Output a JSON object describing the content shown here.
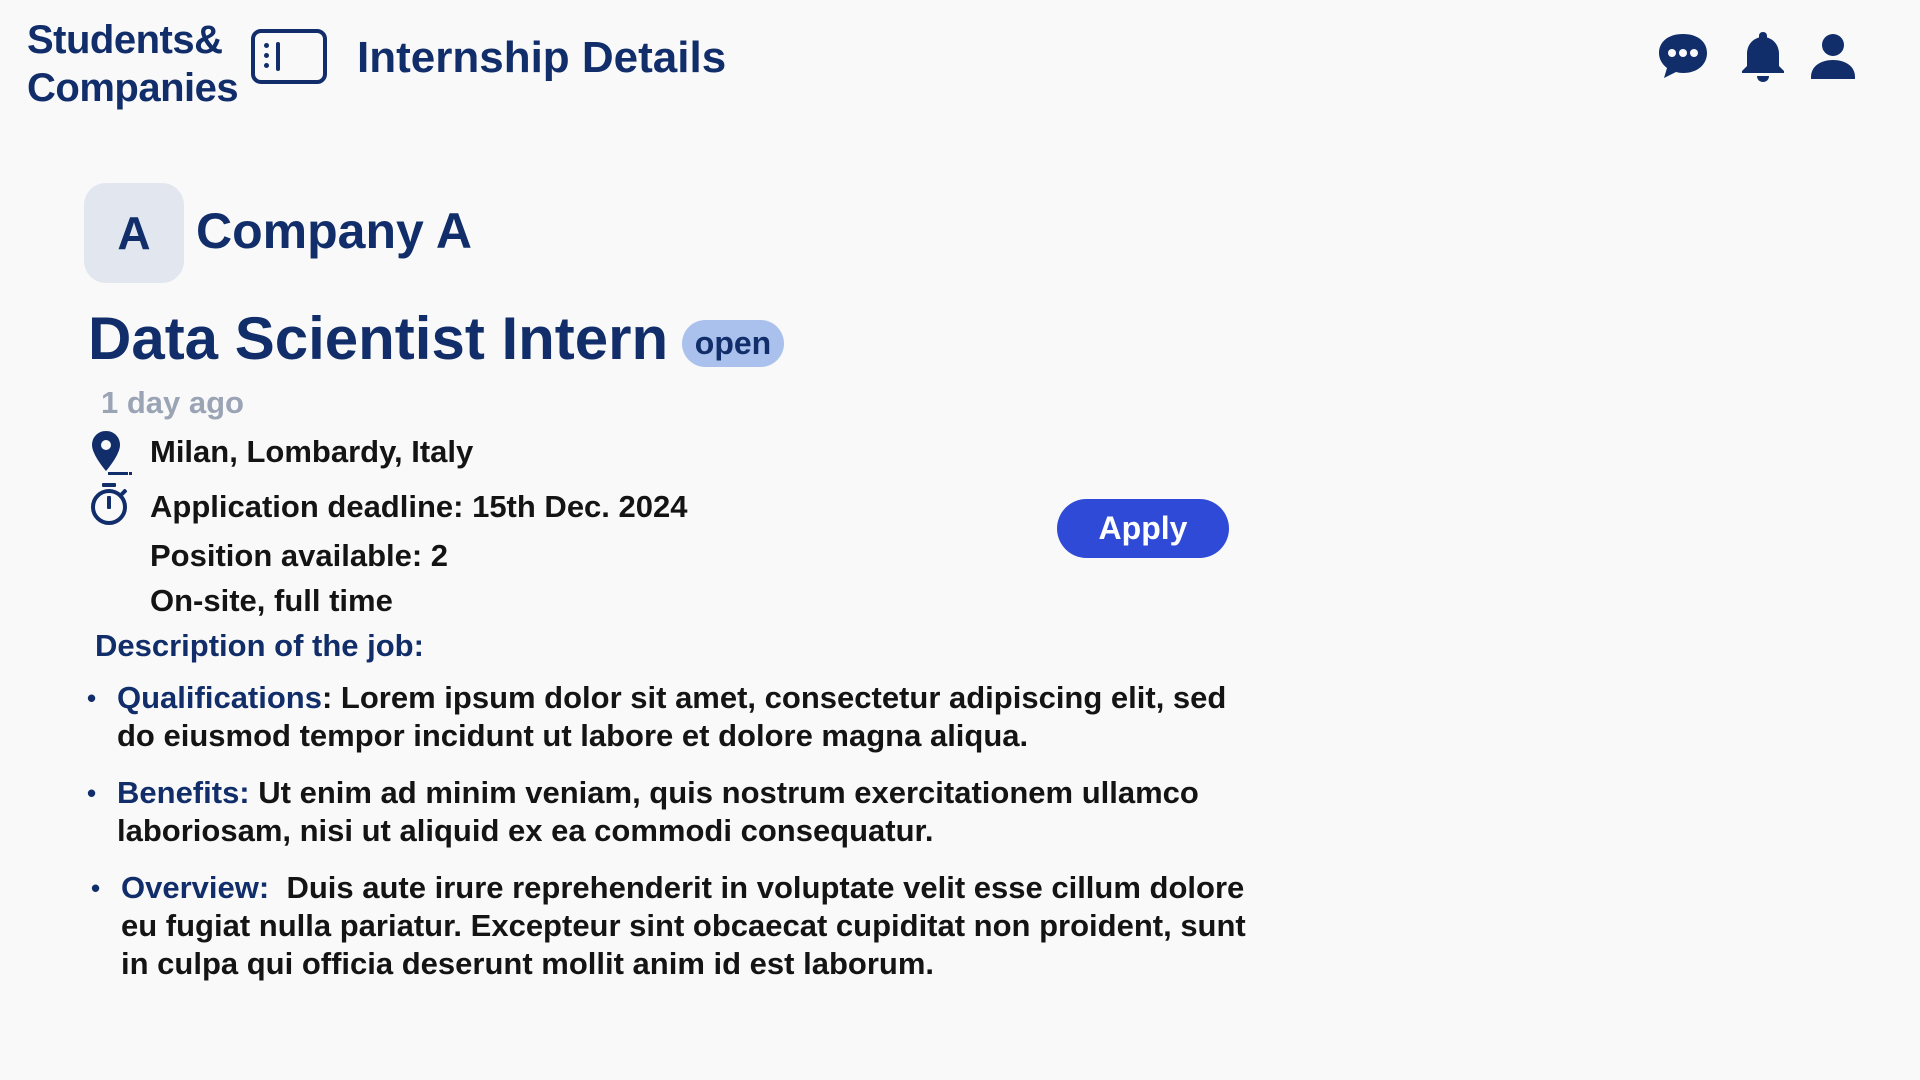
{
  "header": {
    "brand_line1": "Students&",
    "brand_line2": "Companies",
    "title": "Internship Details",
    "icons": [
      "chat-icon",
      "bell-icon",
      "user-icon"
    ]
  },
  "company": {
    "initial": "A",
    "name": "Company A"
  },
  "job": {
    "title": "Data Scientist Intern",
    "status": "open",
    "posted": "1 day ago",
    "location": "Milan,  Lombardy, Italy",
    "deadline": "Application deadline: 15th Dec. 2024",
    "positions": "Position available: 2",
    "mode": "On-site, full time",
    "apply_label": "Apply"
  },
  "description": {
    "heading": "Description of the job:",
    "items": [
      {
        "key": "Qualifications",
        "sep": ": ",
        "text": "Lorem ipsum dolor sit amet, consectetur adipiscing elit, sed do eiusmod tempor incidunt ut labore et dolore magna aliqua."
      },
      {
        "key": "Benefits:",
        "sep": " ",
        "text": "Ut enim ad minim veniam, quis nostrum exercitationem ullamco laboriosam, nisi ut aliquid ex ea commodi consequatur."
      },
      {
        "key": "Overview:",
        "sep": "  ",
        "text": "Duis aute irure reprehenderit in voluptate velit esse cillum dolore eu fugiat nulla pariatur. Excepteur sint obcaecat cupiditat non proident, sunt in culpa qui officia deserunt mollit anim id est laborum."
      }
    ]
  },
  "colors": {
    "primary": "#112e6a",
    "accent": "#2e4ad6",
    "badge": "#a9c1ec",
    "muted": "#9aa4b5",
    "background": "#f9f9f9"
  }
}
